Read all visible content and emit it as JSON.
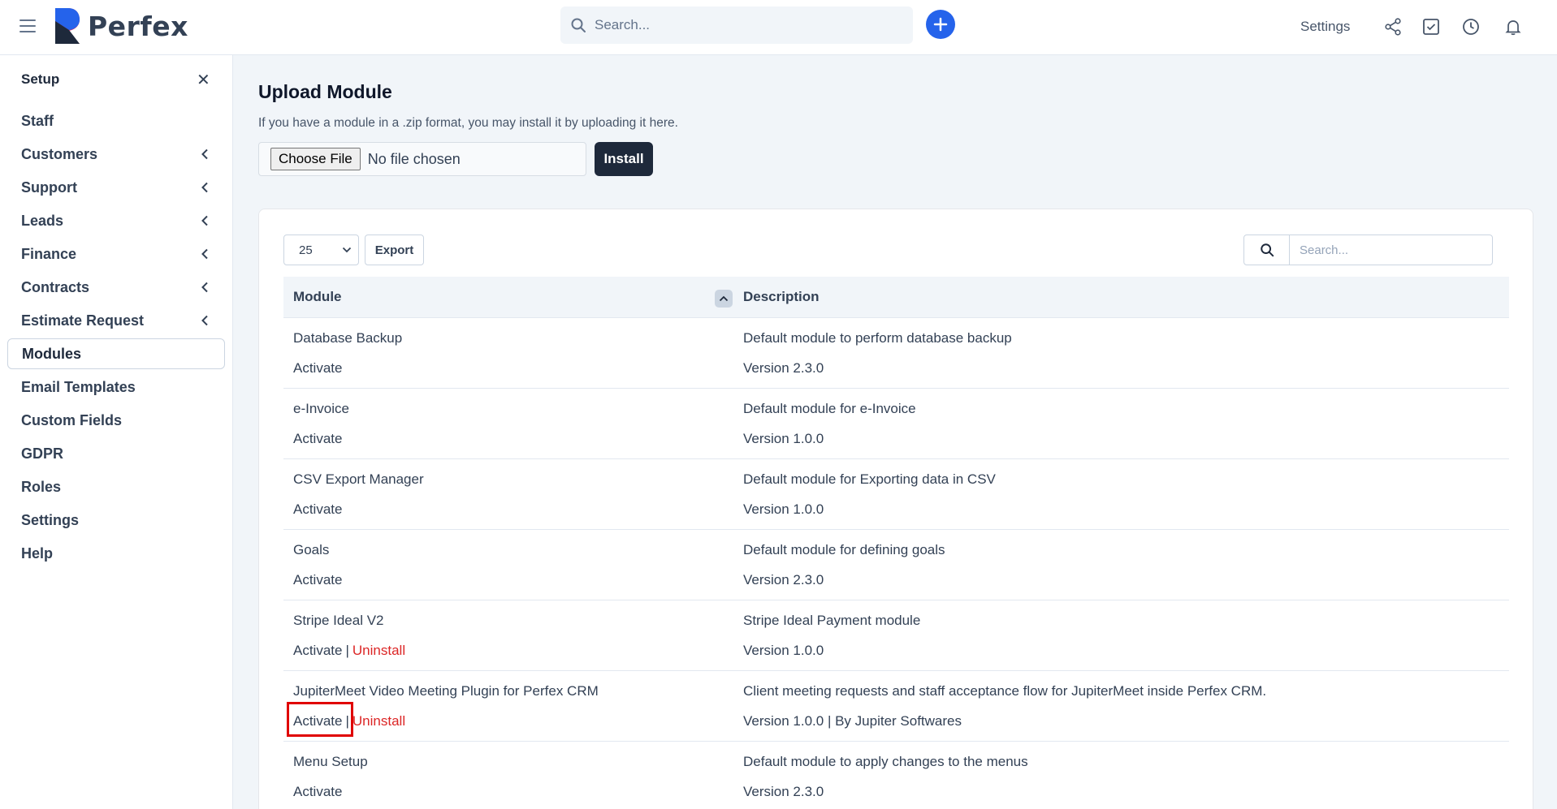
{
  "header": {
    "logo_text": "Perfex",
    "search_placeholder": "Search...",
    "settings_label": "Settings",
    "icons": [
      "menu-icon",
      "search-icon",
      "plus-icon",
      "share-icon",
      "checkbox-icon",
      "clock-icon",
      "bell-icon"
    ],
    "accent_color": "#2563eb"
  },
  "sidebar": {
    "title": "Setup",
    "items": [
      {
        "label": "Staff",
        "has_submenu": false
      },
      {
        "label": "Customers",
        "has_submenu": true
      },
      {
        "label": "Support",
        "has_submenu": true
      },
      {
        "label": "Leads",
        "has_submenu": true
      },
      {
        "label": "Finance",
        "has_submenu": true
      },
      {
        "label": "Contracts",
        "has_submenu": true
      },
      {
        "label": "Estimate Request",
        "has_submenu": true
      },
      {
        "label": "Modules",
        "has_submenu": false,
        "active": true
      },
      {
        "label": "Email Templates",
        "has_submenu": false
      },
      {
        "label": "Custom Fields",
        "has_submenu": false
      },
      {
        "label": "GDPR",
        "has_submenu": false
      },
      {
        "label": "Roles",
        "has_submenu": false
      },
      {
        "label": "Settings",
        "has_submenu": false
      },
      {
        "label": "Help",
        "has_submenu": false
      }
    ]
  },
  "upload": {
    "title": "Upload Module",
    "subtitle": "If you have a module in a .zip format, you may install it by uploading it here.",
    "choose_file_label": "Choose File",
    "no_file_text": "No file chosen",
    "install_label": "Install"
  },
  "table": {
    "page_length": "25",
    "export_label": "Export",
    "search_placeholder": "Search...",
    "columns": [
      "Module",
      "Description"
    ],
    "rows": [
      {
        "name": "Database Backup",
        "action": "Activate",
        "uninstall": "",
        "description": "Default module to perform database backup",
        "version": "Version 2.3.0"
      },
      {
        "name": "e-Invoice",
        "action": "Activate",
        "uninstall": "",
        "description": "Default module for e-Invoice",
        "version": "Version 1.0.0"
      },
      {
        "name": "CSV Export Manager",
        "action": "Activate",
        "uninstall": "",
        "description": "Default module for Exporting data in CSV",
        "version": "Version 1.0.0"
      },
      {
        "name": "Goals",
        "action": "Activate",
        "uninstall": "",
        "description": "Default module for defining goals",
        "version": "Version 2.3.0"
      },
      {
        "name": "Stripe Ideal V2",
        "action": "Activate",
        "uninstall": "Uninstall",
        "description": "Stripe Ideal Payment module",
        "version": "Version 1.0.0"
      },
      {
        "name": "JupiterMeet Video Meeting Plugin for Perfex CRM",
        "action": "Activate",
        "uninstall": "Uninstall",
        "description": "Client meeting requests and staff acceptance flow for JupiterMeet inside Perfex CRM.",
        "version": "Version 1.0.0 | By Jupiter Softwares"
      },
      {
        "name": "Menu Setup",
        "action": "Activate",
        "uninstall": "",
        "description": "Default module to apply changes to the menus",
        "version": "Version 2.3.0"
      }
    ],
    "danger_color": "#dc2626",
    "highlight_color": "#e00000"
  }
}
